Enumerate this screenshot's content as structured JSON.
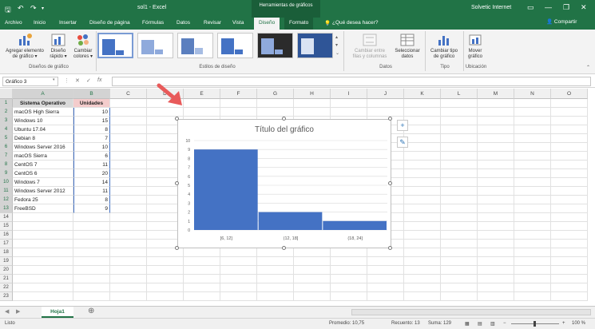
{
  "window": {
    "doc_title": "sol1 - Excel",
    "context_header": "Herramientas de gráficos",
    "user": "Solvetic Internet"
  },
  "tabs": [
    {
      "label": "Archivo"
    },
    {
      "label": "Inicio"
    },
    {
      "label": "Insertar"
    },
    {
      "label": "Diseño de página"
    },
    {
      "label": "Fórmulas"
    },
    {
      "label": "Datos"
    },
    {
      "label": "Revisar"
    },
    {
      "label": "Vista"
    },
    {
      "label": "Diseño"
    },
    {
      "label": "Formato"
    }
  ],
  "tell_me": "¿Qué desea hacer?",
  "share_label": "Compartir",
  "ribbon": {
    "add_element": "Agregar elemento\nde gráfico ▾",
    "quick_layout": "Diseño\nrápido ▾",
    "change_colors": "Cambiar\ncolores ▾",
    "group_layouts": "Diseños de gráfico",
    "group_styles": "Estilos de diseño",
    "switch_rowcol": "Cambiar entre\nfilas y columnas",
    "select_data": "Seleccionar\ndatos",
    "group_data": "Datos",
    "change_type": "Cambiar tipo\nde gráfico",
    "group_type": "Tipo",
    "move_chart": "Mover\ngráfico",
    "group_location": "Ubicación"
  },
  "formula_bar": {
    "name_box": "Gráfico 3",
    "cancel": "✕",
    "enter": "✓",
    "fx": "fx"
  },
  "columns": [
    "A",
    "B",
    "C",
    "D",
    "E",
    "F",
    "G",
    "H",
    "I",
    "J",
    "K",
    "L",
    "M",
    "N",
    "O"
  ],
  "rows": [
    "1",
    "2",
    "3",
    "4",
    "5",
    "6",
    "7",
    "8",
    "9",
    "10",
    "11",
    "12",
    "13",
    "14",
    "15",
    "16",
    "17",
    "18",
    "19",
    "20",
    "21",
    "22",
    "23"
  ],
  "table": {
    "headers": [
      "Sistema Operativo",
      "Unidades"
    ],
    "data": [
      [
        "macOS High Sierra",
        "10"
      ],
      [
        "Windows 10",
        "15"
      ],
      [
        "Ubuntu 17.04",
        "8"
      ],
      [
        "Debian 8",
        "7"
      ],
      [
        "Windows Server 2016",
        "10"
      ],
      [
        "macOS Sierra",
        "6"
      ],
      [
        "CentOS 7",
        "11"
      ],
      [
        "CentOS 6",
        "20"
      ],
      [
        "Windows 7",
        "14"
      ],
      [
        "Windows Server 2012",
        "11"
      ],
      [
        "Fedora 25",
        "8"
      ],
      [
        "FreeBSD",
        "9"
      ]
    ]
  },
  "chart_side_buttons": {
    "plus": "+",
    "brush": "✎"
  },
  "chart_data": {
    "type": "bar",
    "title": "Título del gráfico",
    "categories": [
      "[6, 12]",
      "(12, 18]",
      "(18, 24]"
    ],
    "values": [
      9,
      2,
      1
    ],
    "ylim": [
      0,
      10
    ],
    "yticks": [
      "0",
      "1",
      "2",
      "3",
      "4",
      "5",
      "6",
      "7",
      "8",
      "9",
      "10"
    ],
    "bar_color": "#4472c4",
    "grid": true
  },
  "sheet_tab": "Hoja1",
  "status": {
    "ready": "Listo",
    "average": "Promedio: 10,75",
    "count": "Recuento: 13",
    "sum": "Suma: 129",
    "zoom": "100 %"
  },
  "colors": {
    "excel_green": "#217346",
    "series_blue": "#4472c4"
  }
}
